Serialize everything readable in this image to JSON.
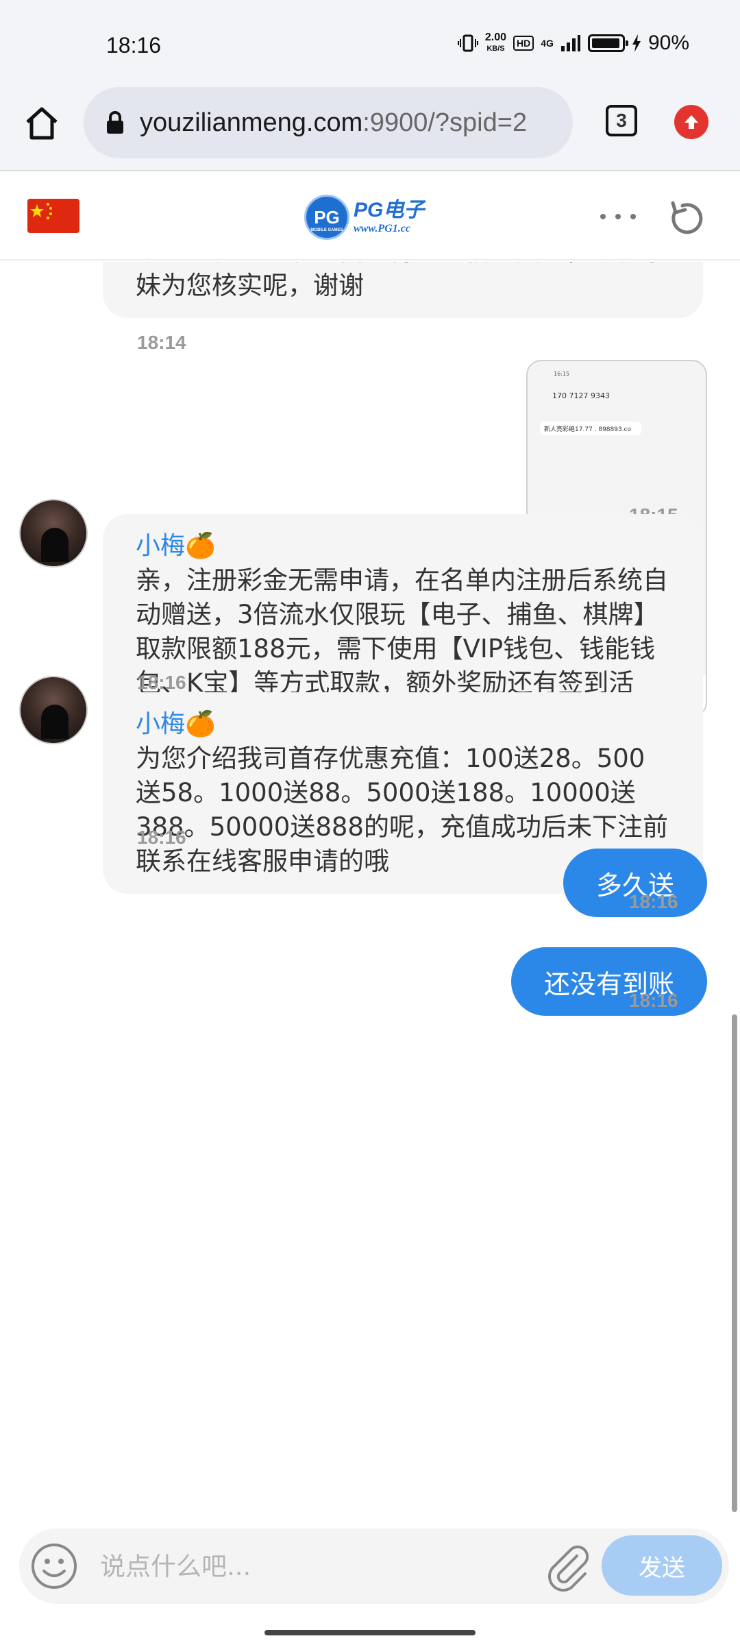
{
  "status_bar": {
    "time": "18:16",
    "net_speed_value": "2.00",
    "net_speed_unit": "KB/S",
    "hd_label": "HD",
    "network_type": "4G",
    "battery_percent": "90%"
  },
  "browser": {
    "url_host": "youzilianmeng.com",
    "url_rest": ":9900/?spid=2",
    "tab_count": "3"
  },
  "site_header": {
    "logo_badge": "PG",
    "logo_badge_sub": "MOBILE GAMES",
    "logo_title": "PG电子",
    "logo_url": "www.PG1.cc"
  },
  "chat": {
    "messages": [
      {
        "type": "incoming",
        "text": "请您提供一个收到我司得赠短信截图呢，以便小妹为您核实呢，谢谢",
        "time": "18:14"
      },
      {
        "type": "outgoing-image",
        "time": "18:15",
        "image_status_time": "16:15",
        "image_contact": "170 7127 9343",
        "image_sms": "新人亮彩绝17.77 . 898893.co"
      },
      {
        "type": "incoming",
        "sender": "小梅🍊",
        "text": "亲，注册彩金无需申请，在名单内注册后系统自动赠送，3倍流水仅限玩【电子、捕鱼、棋牌】取款限额188元，需下使用【VIP钱包、钱能钱包、K宝】等方式取款，额外奖励还有签到活动，请悉知~",
        "time": "18:16"
      },
      {
        "type": "incoming",
        "sender": "小梅🍊",
        "text": "为您介绍我司首存优惠充值：100送28。500送58。1000送88。5000送188。10000送388。50000送888的呢，充值成功后未下注前联系在线客服申请的哦",
        "time": "18:16"
      },
      {
        "type": "outgoing",
        "text": "多久送",
        "time": "18:16"
      },
      {
        "type": "outgoing",
        "text": "还没有到账",
        "time": "18:16"
      }
    ]
  },
  "input_bar": {
    "placeholder": "说点什么吧...",
    "send_label": "发送"
  },
  "colors": {
    "accent": "#2b87e8",
    "send_disabled": "#a8cdf4",
    "incoming_bubble": "#f5f5f5",
    "update_badge": "#e3342f"
  },
  "icons": [
    "home-icon",
    "lock-icon",
    "tabs-icon",
    "update-icon",
    "china-flag-icon",
    "more-icon",
    "refresh-icon",
    "emoji-icon",
    "attachment-icon"
  ]
}
